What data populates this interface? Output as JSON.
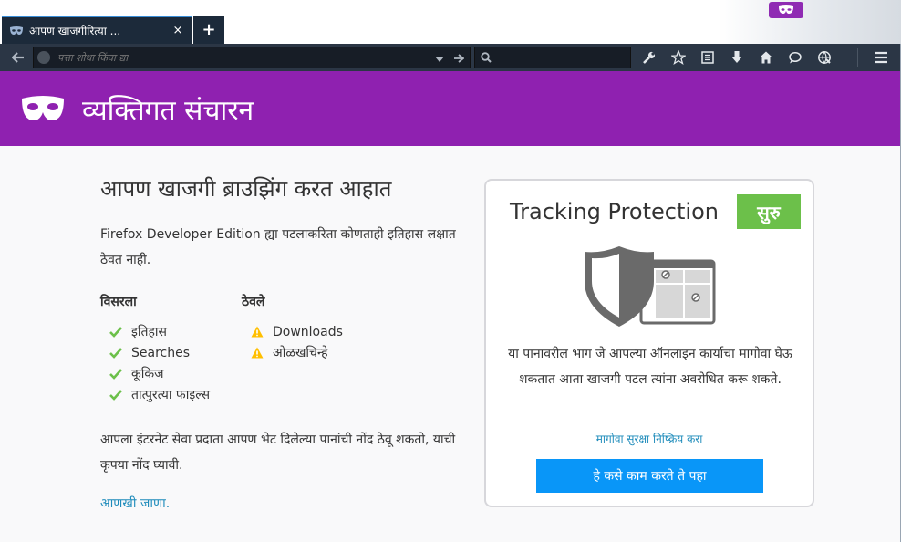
{
  "tab": {
    "title": "आपण खाजगीरित्या ...",
    "close_glyph": "×",
    "new_tab_glyph": "+"
  },
  "navbar": {
    "url_placeholder": "पत्ता शोधा किंवा द्या",
    "search_placeholder": ""
  },
  "header": {
    "title": "व्यक्तिगत संचारन"
  },
  "main": {
    "heading": "आपण खाजगी ब्राउझिंग करत आहात",
    "description": "Firefox Developer Edition ह्या पटलाकरिता कोणताही इतिहास लक्षात ठेवत नाही.",
    "forgets": {
      "heading": "विसरला",
      "items": [
        "इतिहास",
        "Searches",
        "कूकिज",
        "तात्पुरत्या फाइल्स"
      ]
    },
    "keeps": {
      "heading": "ठेवले",
      "items": [
        "Downloads",
        "ओळखचिन्हे"
      ]
    },
    "note": "आपला इंटरनेट सेवा प्रदाता आपण भेट दिलेल्या पानांची नोंद ठेवू शकतो, याची कृपया नोंद घ्यावी.",
    "learn_more": "आणखी जाणा."
  },
  "tracking": {
    "title": "Tracking Protection",
    "toggle_label": "सुरु",
    "description": "या पानावरील भाग जे आपल्या ऑनलाइन कार्याचा मागोवा घेऊ शकतात आता खाजगी पटल त्यांना अवरोधित करू शकते.",
    "disable_link": "मागोवा सुरक्षा निष्क्रिय करा",
    "how_button": "हे कसे काम करते ते पहा"
  },
  "colors": {
    "private_purple": "#8f21b0",
    "toggle_green": "#6cc04a",
    "button_blue": "#0996f8",
    "link_blue": "#1f8cbb",
    "check_green": "#6cc04a",
    "warning_yellow": "#ffbf00"
  },
  "icons": {
    "favicon": "private-mask-icon",
    "back": "back-arrow-icon",
    "search": "search-icon",
    "tools": "wrench-icon",
    "bookmark": "star-icon",
    "reading_list": "reading-list-icon",
    "downloads": "download-icon",
    "home": "home-icon",
    "chat": "chat-icon",
    "webide": "webide-icon",
    "menu": "hamburger-menu-icon"
  }
}
